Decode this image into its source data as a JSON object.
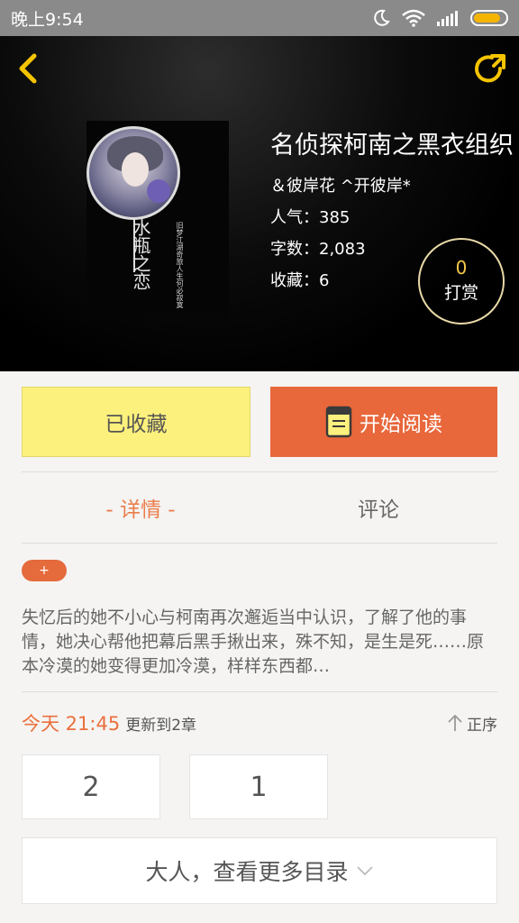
{
  "status_bar": {
    "time": "晚上9:54",
    "icons": [
      "moon-icon",
      "wifi-icon",
      "signal-icon",
      "battery-icon"
    ],
    "battery_level": 0.85
  },
  "header": {
    "back_icon": "chevron-left-icon",
    "share_icon": "share-arrow-icon",
    "accent_color": "#f5c400"
  },
  "book": {
    "title": "名侦探柯南之黑衣组织",
    "author": "＆彼岸花 ^开彼岸*",
    "popularity": "人气：385",
    "word_count": "字数：2,083",
    "favorites": "收藏：6",
    "cover_big_text": "水瓶之恋",
    "cover_small_text": "旧梦江湖奇旅人生何必寂寞"
  },
  "tip": {
    "count": "0",
    "label": "打赏"
  },
  "actions": {
    "collect_label": "已收藏",
    "read_label": "开始阅读",
    "collect_color": "#fdf17d",
    "read_color": "#e8673b"
  },
  "tabs": [
    {
      "label": "- 详情 -",
      "active": true
    },
    {
      "label": "评论",
      "active": false
    }
  ],
  "tag_plus": "+",
  "description": "失忆后的她不小心与柯南再次邂逅当中认识，了解了他的事情，她决心帮他把幕后黑手揪出来，殊不知，是生是死……原本冷漠的她变得更加冷漠，样样东西都…",
  "update": {
    "time": "今天 21:45",
    "text": "更新到2章",
    "sort_label": "正序"
  },
  "chapters": [
    "2",
    "1"
  ],
  "more": {
    "label": "大人，查看更多目录"
  }
}
